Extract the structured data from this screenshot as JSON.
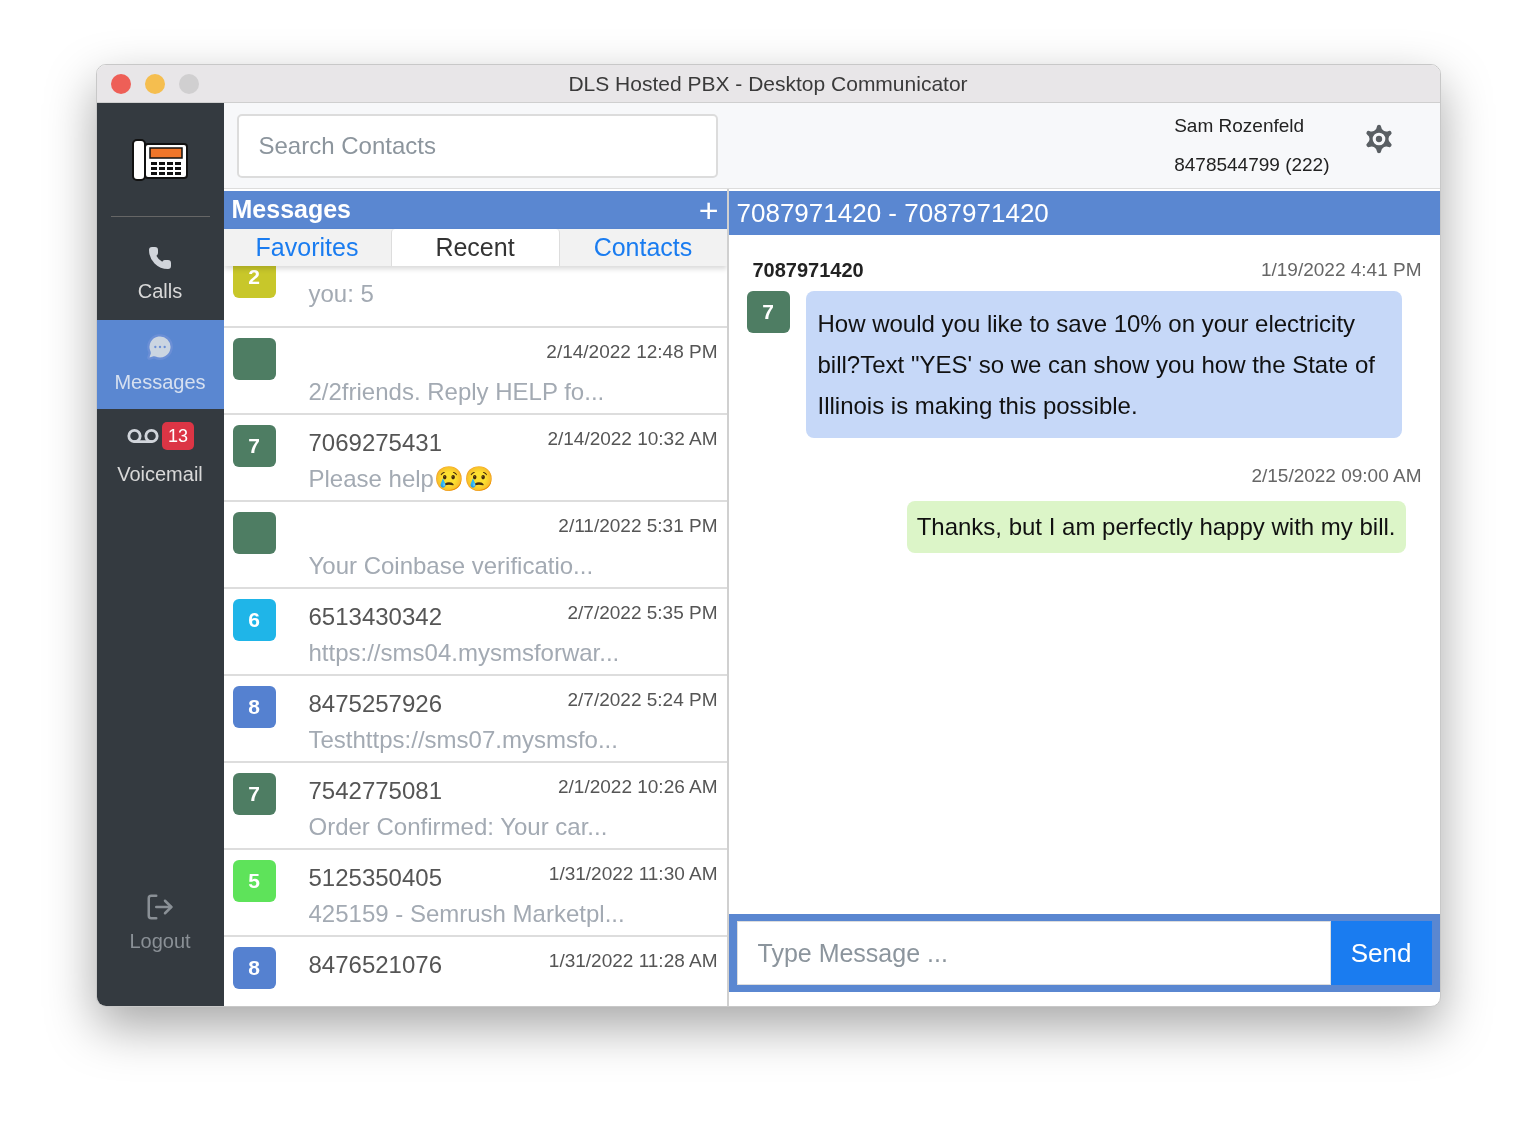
{
  "window": {
    "title": "DLS Hosted PBX - Desktop Communicator"
  },
  "sidebar": {
    "items": [
      {
        "kind": "calls",
        "label": "Calls",
        "selected": false
      },
      {
        "kind": "messages",
        "label": "Messages",
        "selected": true
      },
      {
        "kind": "voicemail",
        "label": "Voicemail",
        "selected": false,
        "badge": "13"
      }
    ],
    "logout": "Logout"
  },
  "search": {
    "placeholder": "Search Contacts"
  },
  "user": {
    "name": "Sam Rozenfeld",
    "number": "8478544799 (222)"
  },
  "messages_panel": {
    "title": "Messages",
    "add": "+",
    "tabs": [
      {
        "label": "Favorites",
        "selected": false
      },
      {
        "label": "Recent",
        "selected": true
      },
      {
        "label": "Contacts",
        "selected": false
      }
    ],
    "threads": [
      {
        "avatar": "2",
        "color": "#c8c72a",
        "preview": "you: 5"
      },
      {
        "color": "#4e7d63",
        "time": "2/14/2022 12:48 PM",
        "preview": "2/2friends. Reply HELP fo..."
      },
      {
        "avatar": "7",
        "color": "#4e7d63",
        "sender": "7069275431",
        "time": "2/14/2022 10:32 AM",
        "preview": "Please help😢😢"
      },
      {
        "color": "#4e7d63",
        "time": "2/11/2022 5:31 PM",
        "preview": "Your Coinbase verificatio..."
      },
      {
        "avatar": "6",
        "color": "#1fb5e8",
        "sender": "6513430342",
        "time": "2/7/2022 5:35 PM",
        "preview": "https://sms04.mysmsforwar..."
      },
      {
        "avatar": "8",
        "color": "#5581d0",
        "sender": "8475257926",
        "time": "2/7/2022 5:24 PM",
        "preview": "Testhttps://sms07.mysmsfo..."
      },
      {
        "avatar": "7",
        "color": "#4e7d63",
        "sender": "7542775081",
        "time": "2/1/2022 10:26 AM",
        "preview": "Order Confirmed: Your car..."
      },
      {
        "avatar": "5",
        "color": "#5ee35a",
        "sender": "5125350405",
        "time": "1/31/2022 11:30 AM",
        "preview": "425159 - Semrush Marketpl..."
      },
      {
        "avatar": "8",
        "color": "#5581d0",
        "sender": "8476521076",
        "time": "1/31/2022 11:28 AM"
      }
    ]
  },
  "conversation": {
    "title": "7087971420 - 7087971420",
    "messages": [
      {
        "kind": "incoming",
        "sender": "7087971420",
        "avatar": "7",
        "color": "#4e7d63",
        "time": "1/19/2022 4:41 PM",
        "text": "How would you like to save 10% on your electricity bill?Text \"YES' so we can show you how the State of Illinois is making this possible."
      },
      {
        "kind": "outgoing",
        "time": "2/15/2022 09:00 AM",
        "text": "Thanks, but I am perfectly happy with my bill."
      }
    ],
    "input": {
      "placeholder": "Type Message ..."
    },
    "send": "Send"
  }
}
